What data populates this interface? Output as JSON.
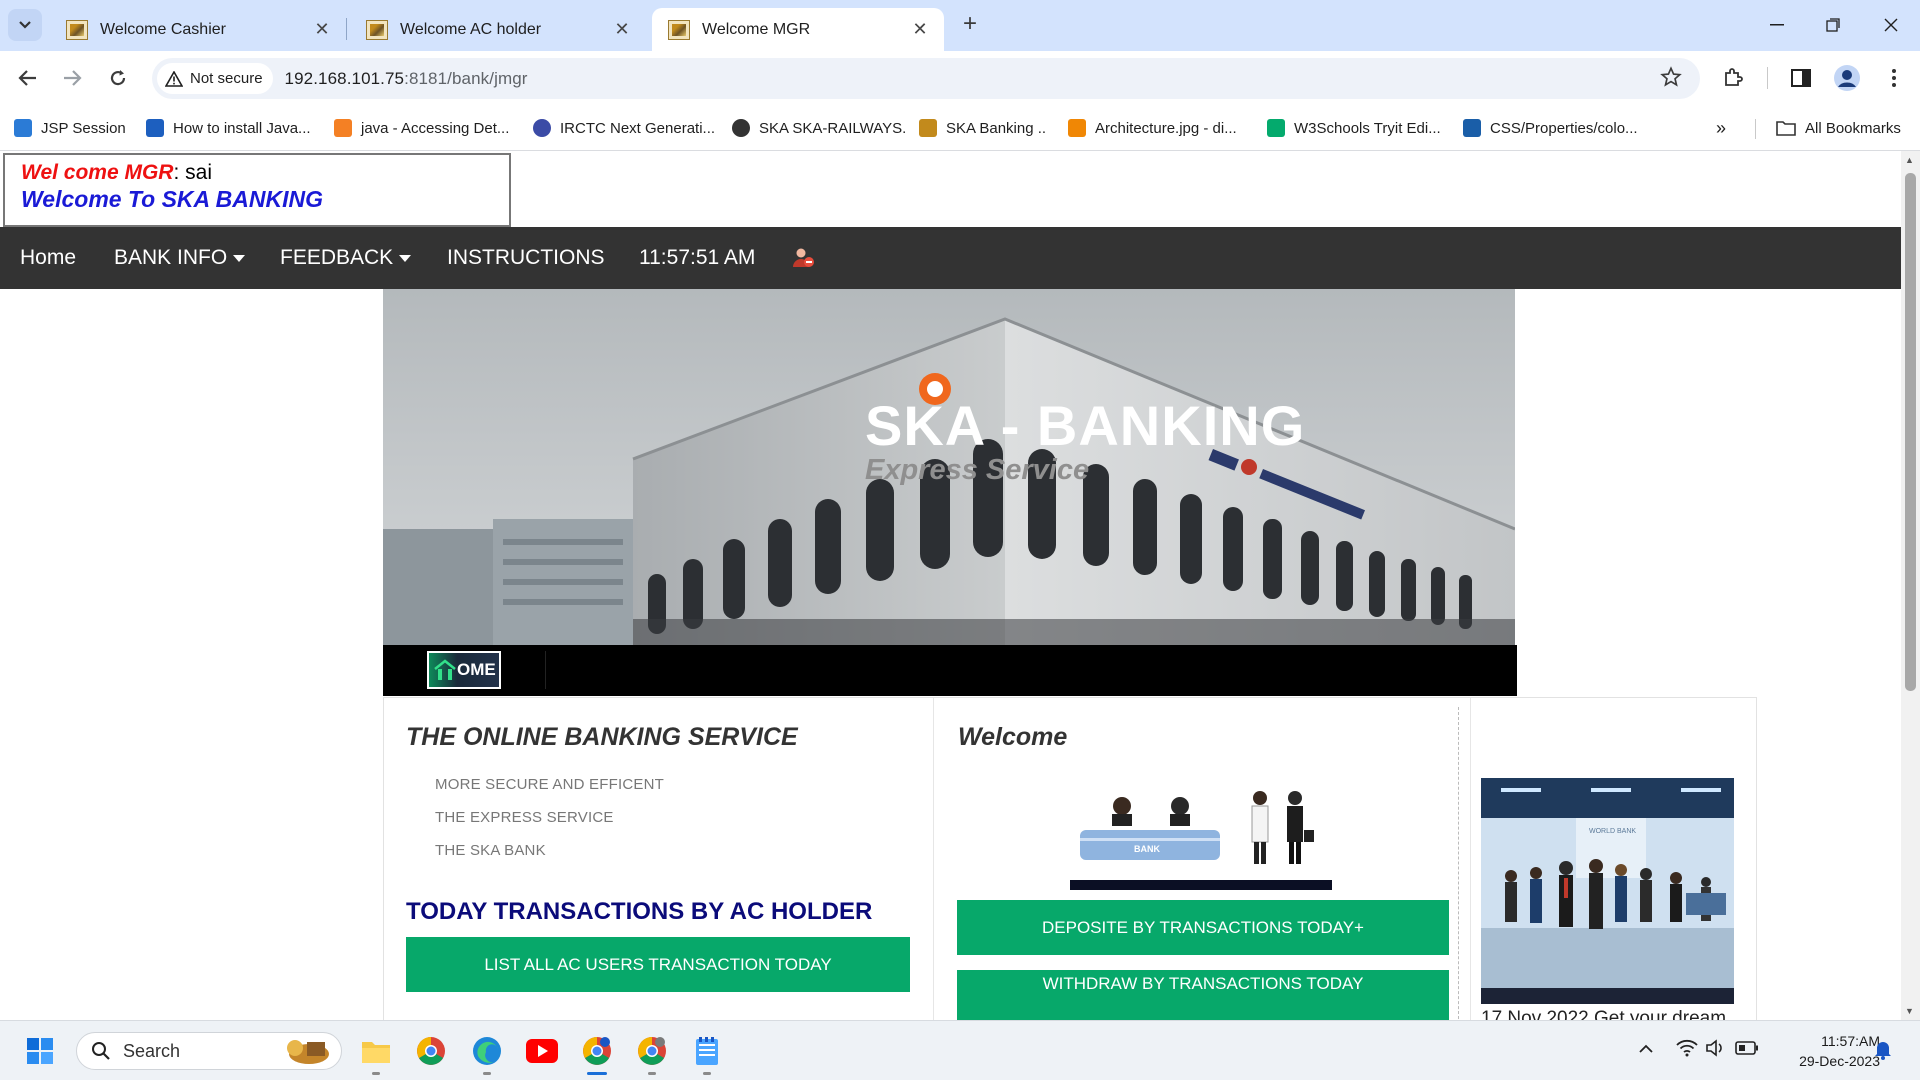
{
  "browser": {
    "tabs": [
      {
        "label": "Welcome Cashier",
        "active": false
      },
      {
        "label": "Welcome AC holder",
        "active": false
      },
      {
        "label": "Welcome MGR",
        "active": true
      }
    ],
    "new_tab_icon": "plus-icon",
    "security_label": "Not secure",
    "url_host": "192.168.101.75",
    "url_path": ":8181/bank/jmgr",
    "bookmarks": [
      {
        "label": "JSP Session",
        "icon": "w-logo",
        "color": "#2b7bd6"
      },
      {
        "label": "How to install Java...",
        "icon": "lc-logo",
        "color": "#1d5fbf"
      },
      {
        "label": "java - Accessing Det...",
        "icon": "stackoverflow-logo",
        "color": "#f48024"
      },
      {
        "label": "IRCTC Next Generati...",
        "icon": "irctc-logo",
        "color": "#3b4ba6"
      },
      {
        "label": "SKA SKA-RAILWAYS.",
        "icon": "globe-icon",
        "color": "#333333"
      },
      {
        "label": "SKA Banking ..",
        "icon": "bank-logo",
        "color": "#c28a1c"
      },
      {
        "label": "Architecture.jpg - di...",
        "icon": "drawio-logo",
        "color": "#f08705"
      },
      {
        "label": "W3Schools Tryit Edi...",
        "icon": "w3-logo",
        "color": "#04aa6d"
      },
      {
        "label": "CSS/Properties/colo...",
        "icon": "w3c-logo",
        "color": "#1a5ea8"
      }
    ],
    "all_bookmarks_label": "All Bookmarks"
  },
  "page": {
    "welcome_prefix": "Wel come MGR",
    "welcome_user": ": sai",
    "welcome_line2": "Welcome To SKA BANKING",
    "nav": {
      "home": "Home",
      "bank_info": "BANK INFO",
      "feedback": "FEEDBACK",
      "instructions": "INSTRUCTIONS",
      "time": "11:57:51 AM"
    },
    "hero_title": "SKA - BANKING",
    "hero_subtitle": "Express Service",
    "home_button": "OME",
    "col1": {
      "title": "THE ONLINE BANKING SERVICE",
      "features": [
        "MORE SECURE AND EFFICENT",
        "THE EXPRESS SERVICE",
        "THE SKA BANK"
      ],
      "tx_title": "TODAY TRANSACTIONS BY AC HOLDER",
      "button": "LIST ALL AC USERS TRANSACTION TODAY"
    },
    "col2": {
      "title": "Welcome",
      "bank_sign": "BANK",
      "button_deposit": "DEPOSITE BY TRANSACTIONS TODAY+",
      "button_withdraw": "WITHDRAW BY TRANSACTIONS TODAY"
    },
    "col3": {
      "image_caption": "WORLD BANK",
      "news": "17 Nov 2022 Get your dream"
    },
    "colors": {
      "navbar": "#333333",
      "green_button": "#07a86a",
      "welcome_red": "#ee1111",
      "welcome_blue": "#1a1ad6"
    }
  },
  "taskbar": {
    "search_placeholder": "Search",
    "time": "11:57:AM",
    "date": "29-Dec-2023"
  }
}
